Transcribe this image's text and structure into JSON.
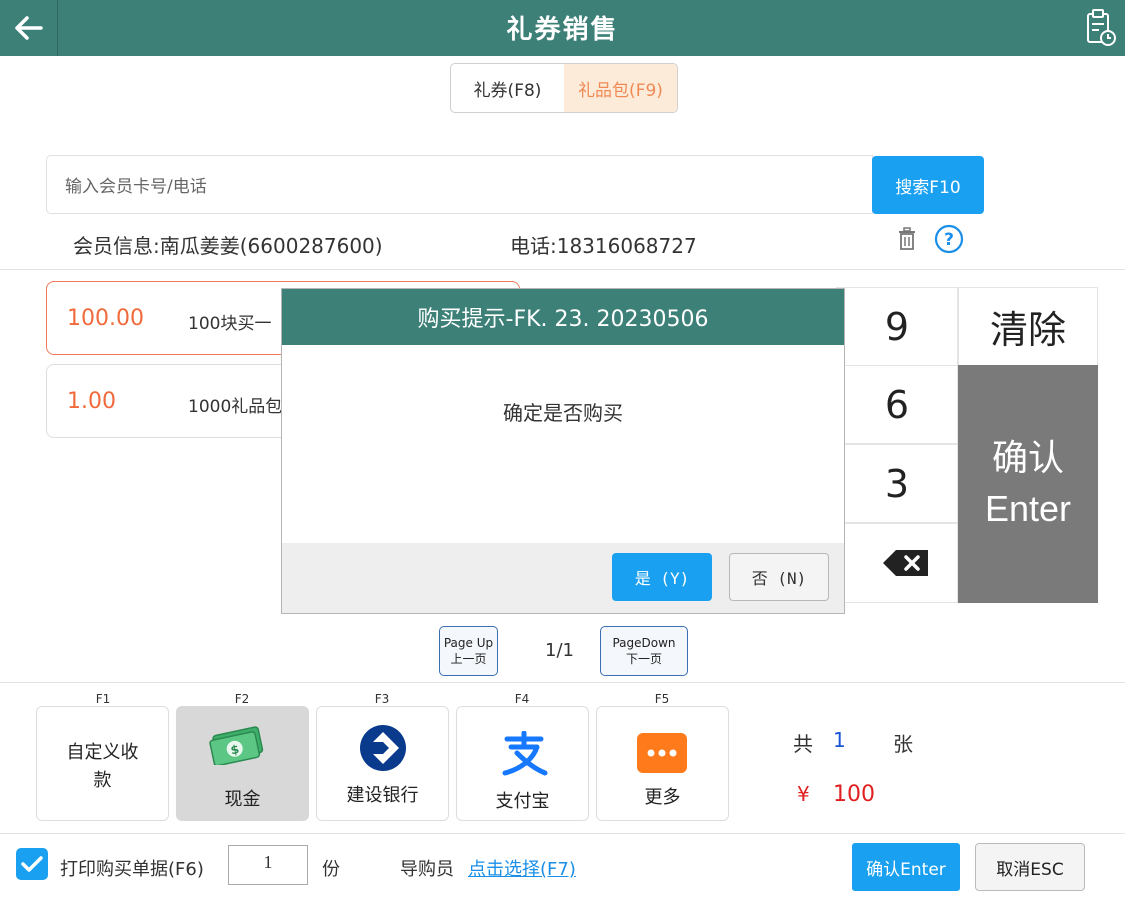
{
  "header": {
    "title": "礼券销售",
    "back_icon": "arrow-left-icon",
    "history_icon": "clipboard-clock-icon"
  },
  "tabs": [
    {
      "label": "礼券(F8)",
      "active": false
    },
    {
      "label": "礼品包(F9)",
      "active": true
    }
  ],
  "search": {
    "placeholder": "输入会员卡号/电话",
    "button_label": "搜索F10"
  },
  "member": {
    "info": "会员信息:南瓜姜姜(6600287600)",
    "phone": "电话:18316068727"
  },
  "items": [
    {
      "price": "100.00",
      "name": "100块买一",
      "selected": true
    },
    {
      "price": "1.00",
      "name": "1000礼品包",
      "selected": false
    }
  ],
  "keypad": {
    "keys": [
      "9",
      "6",
      "3"
    ],
    "clear_label": "清除",
    "enter_line1": "确认",
    "enter_line2": "Enter",
    "backspace_icon": "backspace-icon"
  },
  "modal": {
    "title": "购买提示-FK. 23. 20230506",
    "message": "确定是否购买",
    "yes_label": "是 (Y)",
    "no_label": "否 (N)"
  },
  "pagination": {
    "prev_line1": "Page Up",
    "prev_line2": "上一页",
    "indicator": "1/1",
    "next_line1": "PageDown",
    "next_line2": "下一页"
  },
  "payments": [
    {
      "fkey": "F1",
      "label": "自定义收款"
    },
    {
      "fkey": "F2",
      "label": "现金",
      "icon": "cash-icon"
    },
    {
      "fkey": "F3",
      "label": "建设银行",
      "icon": "ccb-bank-icon"
    },
    {
      "fkey": "F4",
      "label": "支付宝",
      "icon": "alipay-icon"
    },
    {
      "fkey": "F5",
      "label": "更多",
      "icon": "more-icon"
    }
  ],
  "summary": {
    "count_prefix": "共",
    "count": "1",
    "count_suffix": "张",
    "currency": "¥",
    "total": "100"
  },
  "footer": {
    "print_label": "打印购买单据(F6)",
    "print_checked": true,
    "copies": "1",
    "copies_unit": "份",
    "guide_label": "导购员",
    "guide_link": "点击选择(F7)",
    "confirm_label": "确认Enter",
    "cancel_label": "取消ESC"
  },
  "colors": {
    "header": "#3c8078",
    "primary": "#1aa0f0",
    "accent": "#f06a3c",
    "tab_active_bg": "#fdebd9"
  }
}
